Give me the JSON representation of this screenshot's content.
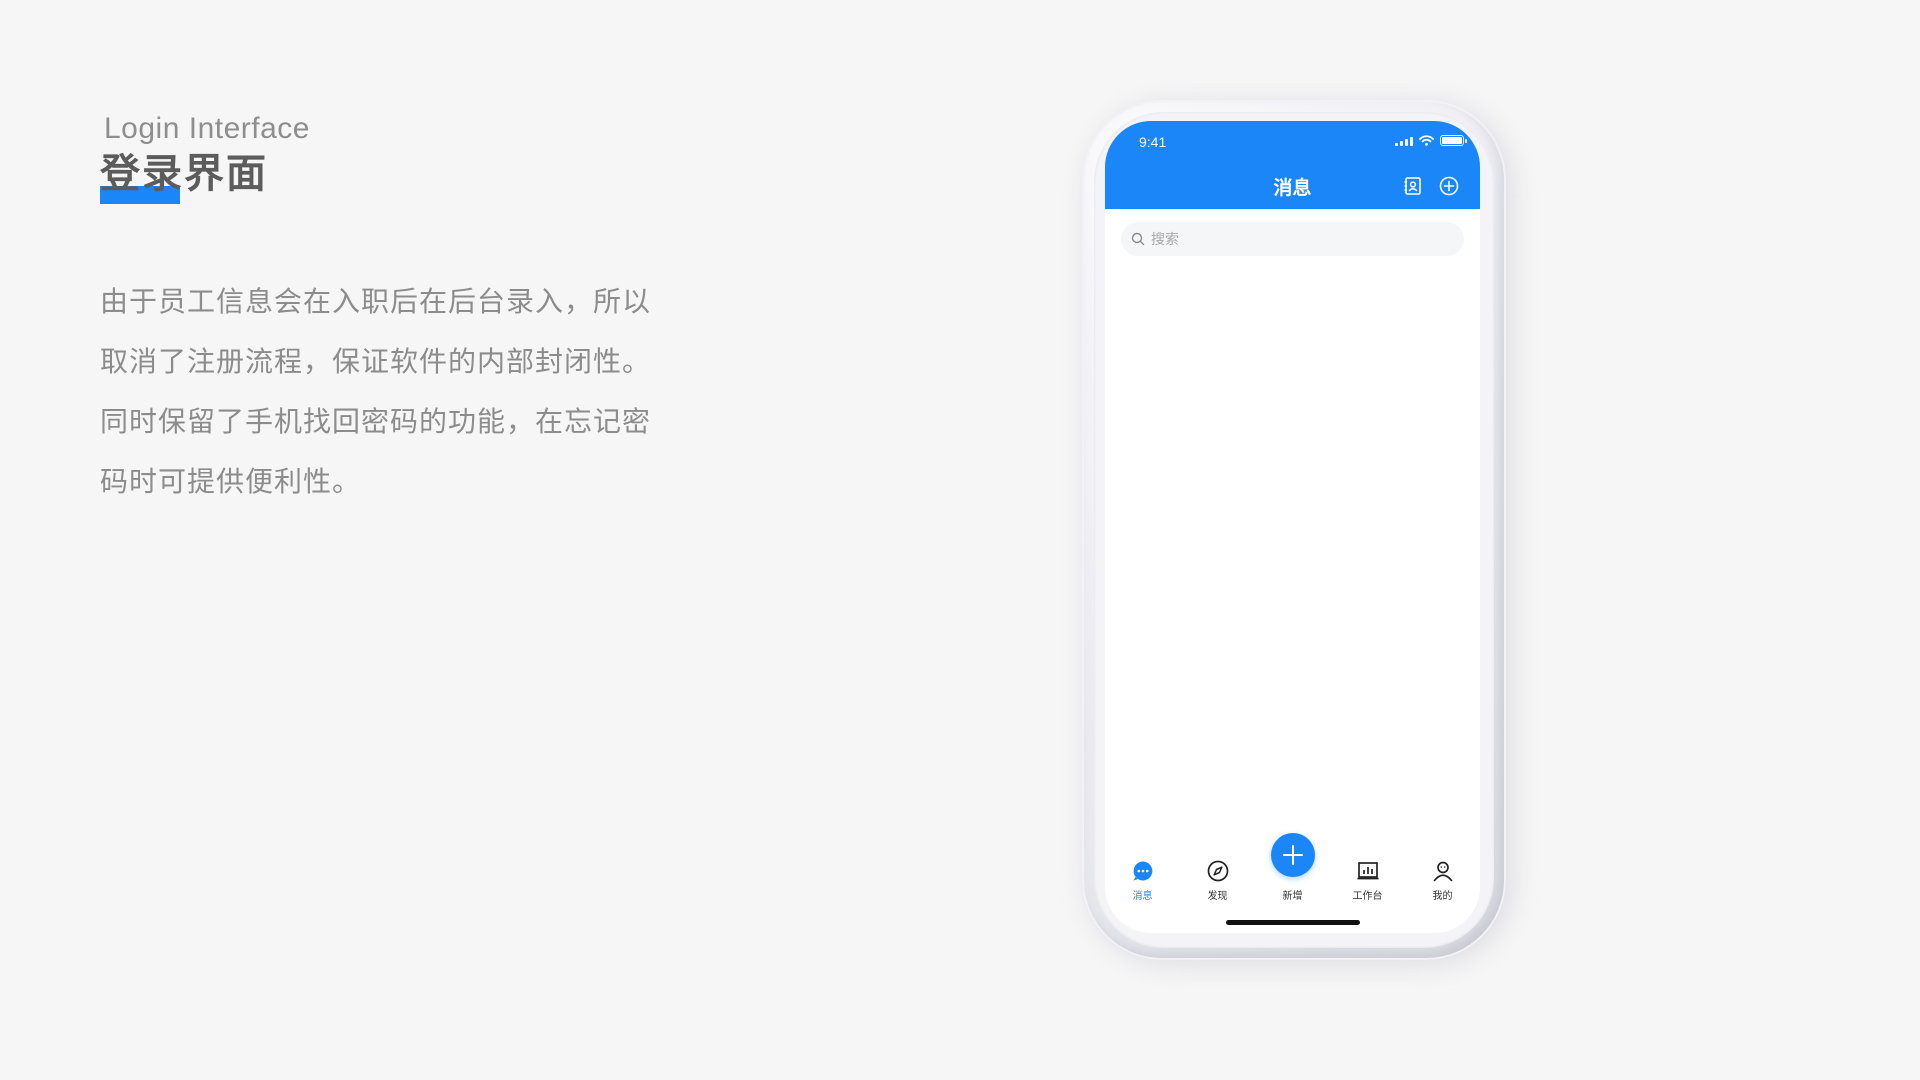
{
  "heading": {
    "subtitle_en": "Login Interface",
    "title_cn": "登录界面"
  },
  "description": {
    "lines": [
      "由于员工信息会在入职后在后台录入，所以",
      "取消了注册流程，保证软件的内部封闭性。",
      "同时保留了手机找回密码的功能，在忘记密",
      "码时可提供便利性。"
    ]
  },
  "phone": {
    "status_bar": {
      "time": "9:41"
    },
    "header": {
      "title": "消息",
      "right_icons": [
        "contacts-card-icon",
        "add-circle-icon"
      ]
    },
    "search": {
      "placeholder": "搜索"
    },
    "tab_bar": {
      "items": [
        {
          "label": "消息",
          "icon": "chat-bubble-icon",
          "active": true
        },
        {
          "label": "发现",
          "icon": "compass-icon",
          "active": false
        },
        {
          "label": "新增",
          "icon": "plus-icon",
          "active": false
        },
        {
          "label": "工作台",
          "icon": "chart-board-icon",
          "active": false
        },
        {
          "label": "我的",
          "icon": "user-icon",
          "active": false
        }
      ]
    }
  },
  "colors": {
    "accent": "#1b86f8",
    "background": "#f6f6f6",
    "text_gray": "#8c8c8c",
    "title_gray": "#5c5c5c"
  }
}
